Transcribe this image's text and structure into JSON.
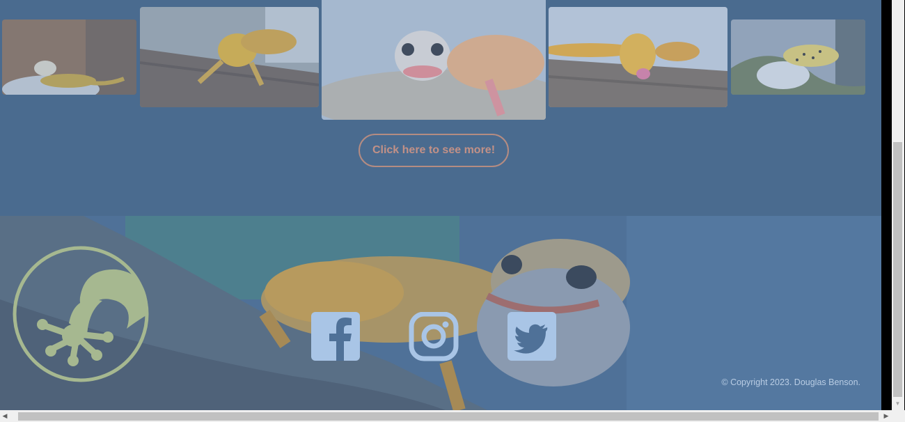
{
  "gallery": {
    "images": [
      {
        "name": "gecko-photo-1",
        "subject": "leopard gecko on rock"
      },
      {
        "name": "gecko-photo-2",
        "subject": "orange leopard gecko on wood"
      },
      {
        "name": "gecko-photo-3",
        "subject": "leopard gecko close-up, featured"
      },
      {
        "name": "gecko-photo-4",
        "subject": "orange gecko licking lips"
      },
      {
        "name": "gecko-photo-5",
        "subject": "spotted gecko on leaves"
      }
    ],
    "see_more_label": "Click here to see more!"
  },
  "footer": {
    "logo_icon": "gecko-foot-logo-icon",
    "social": [
      {
        "name": "facebook-icon",
        "label": "Facebook"
      },
      {
        "name": "instagram-icon",
        "label": "Instagram"
      },
      {
        "name": "twitter-icon",
        "label": "Twitter"
      }
    ],
    "copyright": "© Copyright 2023. Douglas Benson."
  },
  "colors": {
    "gallery_bg": "#4a6b8f",
    "button_border": "#b58c82",
    "logo": "#a6b890",
    "social_icon": "#a9c5e6",
    "copyright_text": "#b9cde4"
  }
}
